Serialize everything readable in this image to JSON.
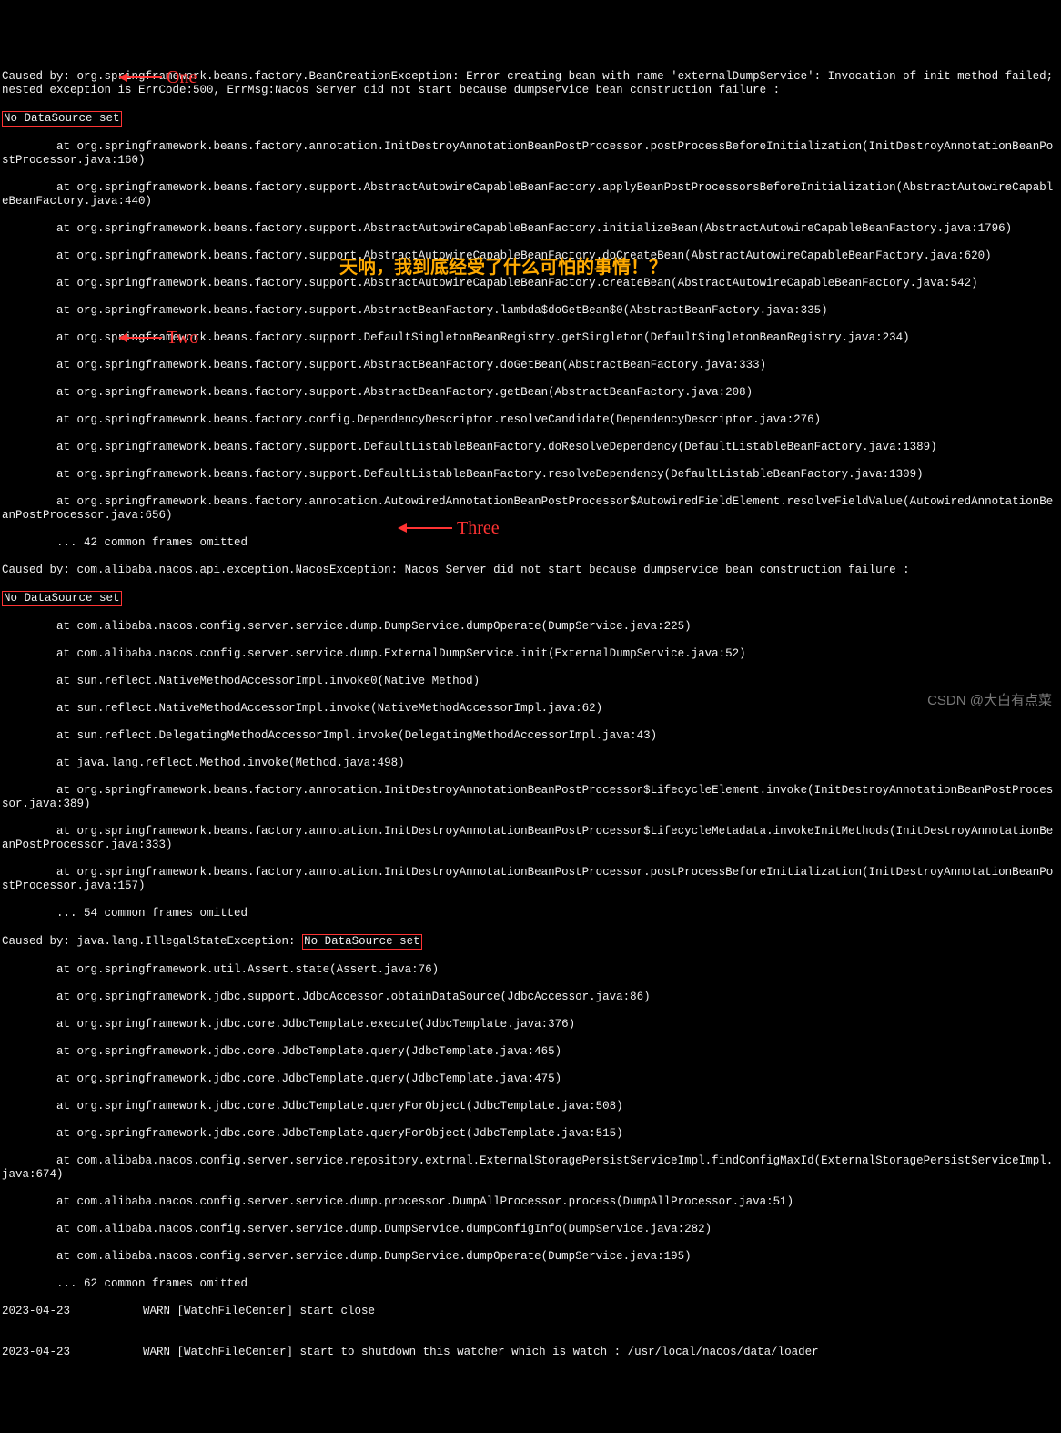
{
  "lines": {
    "l1": "Caused by: org.springframework.beans.factory.BeanCreationException: Error creating bean with name 'externalDumpService': Invocation of init method failed; nested exception is ErrCode:500, ErrMsg:Nacos Server did not start because dumpservice bean construction failure :",
    "box1": "No DataSource set",
    "l3": "        at org.springframework.beans.factory.annotation.InitDestroyAnnotationBeanPostProcessor.postProcessBeforeInitialization(InitDestroyAnnotationBeanPostProcessor.java:160)",
    "l4": "        at org.springframework.beans.factory.support.AbstractAutowireCapableBeanFactory.applyBeanPostProcessorsBeforeInitialization(AbstractAutowireCapableBeanFactory.java:440)",
    "l5": "        at org.springframework.beans.factory.support.AbstractAutowireCapableBeanFactory.initializeBean(AbstractAutowireCapableBeanFactory.java:1796)",
    "l6": "        at org.springframework.beans.factory.support.AbstractAutowireCapableBeanFactory.doCreateBean(AbstractAutowireCapableBeanFactory.java:620)",
    "l7": "        at org.springframework.beans.factory.support.AbstractAutowireCapableBeanFactory.createBean(AbstractAutowireCapableBeanFactory.java:542)",
    "l8": "        at org.springframework.beans.factory.support.AbstractBeanFactory.lambda$doGetBean$0(AbstractBeanFactory.java:335)",
    "l9": "        at org.springframework.beans.factory.support.DefaultSingletonBeanRegistry.getSingleton(DefaultSingletonBeanRegistry.java:234)",
    "l10": "        at org.springframework.beans.factory.support.AbstractBeanFactory.doGetBean(AbstractBeanFactory.java:333)",
    "l11": "        at org.springframework.beans.factory.support.AbstractBeanFactory.getBean(AbstractBeanFactory.java:208)",
    "l12": "        at org.springframework.beans.factory.config.DependencyDescriptor.resolveCandidate(DependencyDescriptor.java:276)",
    "l13": "        at org.springframework.beans.factory.support.DefaultListableBeanFactory.doResolveDependency(DefaultListableBeanFactory.java:1389)",
    "l14": "        at org.springframework.beans.factory.support.DefaultListableBeanFactory.resolveDependency(DefaultListableBeanFactory.java:1309)",
    "l15": "        at org.springframework.beans.factory.annotation.AutowiredAnnotationBeanPostProcessor$AutowiredFieldElement.resolveFieldValue(AutowiredAnnotationBeanPostProcessor.java:656)",
    "l16": "        ... 42 common frames omitted",
    "l17": "Caused by: com.alibaba.nacos.api.exception.NacosException: Nacos Server did not start because dumpservice bean construction failure :",
    "box2": "No DataSource set",
    "l19": "        at com.alibaba.nacos.config.server.service.dump.DumpService.dumpOperate(DumpService.java:225)",
    "l20": "        at com.alibaba.nacos.config.server.service.dump.ExternalDumpService.init(ExternalDumpService.java:52)",
    "l21": "        at sun.reflect.NativeMethodAccessorImpl.invoke0(Native Method)",
    "l22": "        at sun.reflect.NativeMethodAccessorImpl.invoke(NativeMethodAccessorImpl.java:62)",
    "l23": "        at sun.reflect.DelegatingMethodAccessorImpl.invoke(DelegatingMethodAccessorImpl.java:43)",
    "l24": "        at java.lang.reflect.Method.invoke(Method.java:498)",
    "l25": "        at org.springframework.beans.factory.annotation.InitDestroyAnnotationBeanPostProcessor$LifecycleElement.invoke(InitDestroyAnnotationBeanPostProcessor.java:389)",
    "l26": "        at org.springframework.beans.factory.annotation.InitDestroyAnnotationBeanPostProcessor$LifecycleMetadata.invokeInitMethods(InitDestroyAnnotationBeanPostProcessor.java:333)",
    "l27": "        at org.springframework.beans.factory.annotation.InitDestroyAnnotationBeanPostProcessor.postProcessBeforeInitialization(InitDestroyAnnotationBeanPostProcessor.java:157)",
    "l28": "        ... 54 common frames omitted",
    "l29a": "Caused by: java.lang.IllegalStateException: ",
    "box3": "No DataSource set",
    "l30": "        at org.springframework.util.Assert.state(Assert.java:76)",
    "l31": "        at org.springframework.jdbc.support.JdbcAccessor.obtainDataSource(JdbcAccessor.java:86)",
    "l32": "        at org.springframework.jdbc.core.JdbcTemplate.execute(JdbcTemplate.java:376)",
    "l33": "        at org.springframework.jdbc.core.JdbcTemplate.query(JdbcTemplate.java:465)",
    "l34": "        at org.springframework.jdbc.core.JdbcTemplate.query(JdbcTemplate.java:475)",
    "l35": "        at org.springframework.jdbc.core.JdbcTemplate.queryForObject(JdbcTemplate.java:508)",
    "l36": "        at org.springframework.jdbc.core.JdbcTemplate.queryForObject(JdbcTemplate.java:515)",
    "l37": "        at com.alibaba.nacos.config.server.service.repository.extrnal.ExternalStoragePersistServiceImpl.findConfigMaxId(ExternalStoragePersistServiceImpl.java:674)",
    "l38": "        at com.alibaba.nacos.config.server.service.dump.processor.DumpAllProcessor.process(DumpAllProcessor.java:51)",
    "l39": "        at com.alibaba.nacos.config.server.service.dump.DumpService.dumpConfigInfo(DumpService.java:282)",
    "l40": "        at com.alibaba.nacos.config.server.service.dump.DumpService.dumpOperate(DumpService.java:195)",
    "l41": "        ... 62 common frames omitted",
    "l42a": "2023-04-23 ",
    "l42b": " WARN [WatchFileCenter] start close",
    "l43": "",
    "l44a": "2023-04-23 ",
    "l44b": " WARN [WatchFileCenter] start to shutdown this watcher which is watch : /usr/local/nacos/data/loader"
  },
  "annotations": {
    "one": "One",
    "two": "Two",
    "three": "Three",
    "chinese": "天呐，我到底经受了什么可怕的事情！？"
  },
  "watermark": "CSDN @大白有点菜"
}
